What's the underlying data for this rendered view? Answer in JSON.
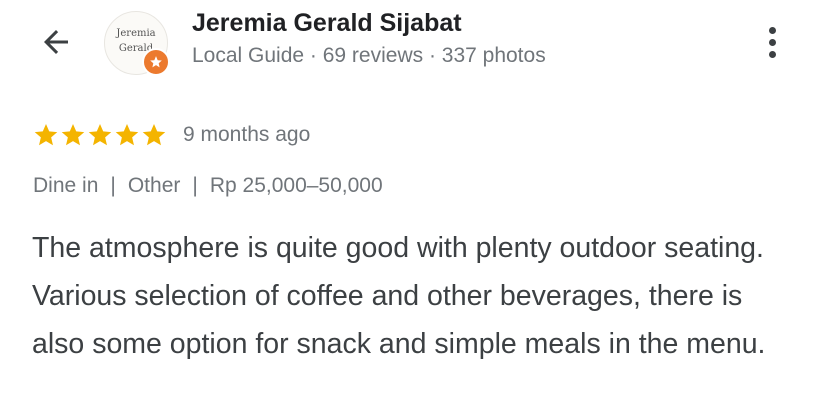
{
  "header": {
    "back_icon": "arrow-left-icon",
    "avatar": {
      "line1": "Jeremia",
      "line2": "Gerald",
      "badge_icon": "local-guide-star-icon",
      "badge_color": "#ec7a2e"
    },
    "name": "Jeremia Gerald Sijabat",
    "meta": "Local Guide · 69 reviews · 337 photos",
    "more_icon": "more-vertical-icon"
  },
  "review": {
    "rating": 5,
    "max_rating": 5,
    "star_color": "#f4b400",
    "time": "9 months ago",
    "attributes": [
      "Dine in",
      "Other",
      "Rp 25,000–50,000"
    ],
    "separator": "|",
    "text": "The atmosphere is quite good with plenty outdoor seating. Various selection of coffee and other beverages, there is also some option for snack and simple meals in the menu."
  }
}
